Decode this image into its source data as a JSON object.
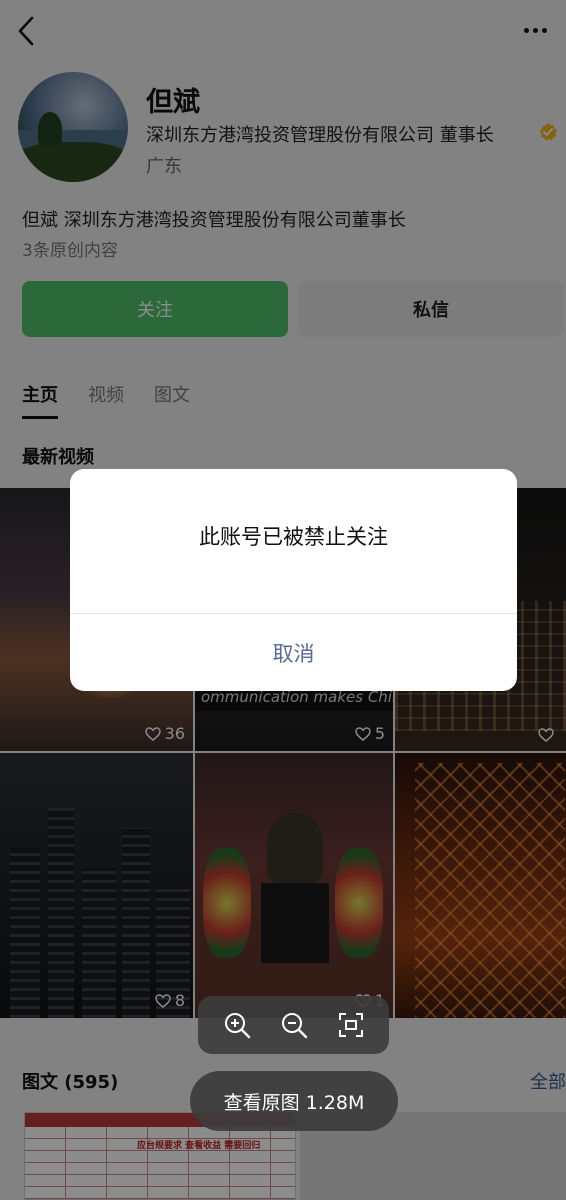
{
  "profile": {
    "name": "但斌",
    "company_title": "深圳东方港湾投资管理股份有限公司 董事长",
    "region": "广东",
    "bio": "但斌 深圳东方港湾投资管理股份有限公司董事长",
    "original_count": "3条原创内容"
  },
  "actions": {
    "follow": "关注",
    "message": "私信"
  },
  "tabs": [
    "主页",
    "视频",
    "图文"
  ],
  "latest_videos_title": "最新视频",
  "videos": [
    {
      "likes": "36"
    },
    {
      "likes": "5",
      "ticker": "ommunication makes China stro"
    },
    {
      "likes": ""
    },
    {
      "likes": "8"
    },
    {
      "likes": "1"
    },
    {
      "likes": ""
    }
  ],
  "graphics": {
    "title": "图文 (595)",
    "all_link": "全部",
    "doc_stamp": "应台规要求 查看收益 需要回归"
  },
  "dialog": {
    "message": "此账号已被禁止关注",
    "cancel": "取消"
  },
  "viewer": {
    "view_original": "查看原图 1.28M"
  },
  "colors": {
    "follow_green": "#4fbf6a",
    "link_blue": "#576b95",
    "verify_gold": "#f2b21c"
  },
  "icons": [
    "back-icon",
    "more-icon",
    "verified-icon",
    "heart-icon",
    "zoom-in-icon",
    "zoom-out-icon",
    "fit-screen-icon"
  ]
}
